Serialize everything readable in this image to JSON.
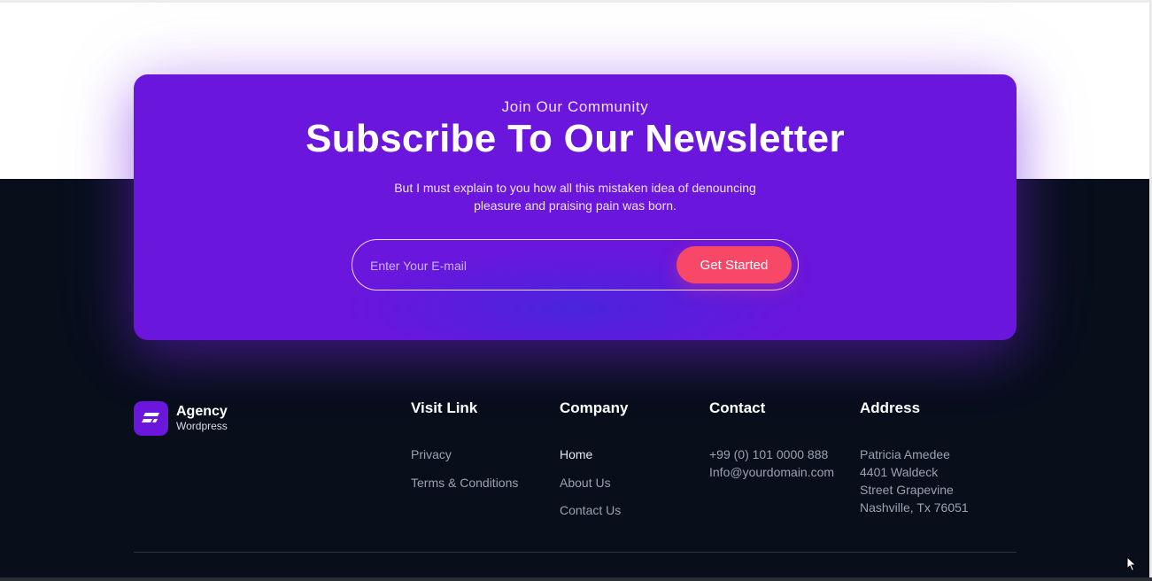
{
  "newsletter": {
    "kicker": "Join Our Community",
    "title": "Subscribe To Our Newsletter",
    "description_line1": "But I must explain to you how all this mistaken idea of denouncing",
    "description_line2": "pleasure and praising pain was born.",
    "email_placeholder": "Enter Your E-mail",
    "button_label": "Get Started"
  },
  "brand": {
    "name": "Agency",
    "subtitle": "Wordpress"
  },
  "footer": {
    "visit": {
      "heading": "Visit Link",
      "links": [
        "Privacy",
        "Terms & Conditions"
      ]
    },
    "company": {
      "heading": "Company",
      "links": [
        "Home",
        "About Us",
        "Contact Us"
      ]
    },
    "contact": {
      "heading": "Contact",
      "lines": [
        "+99 (0) 101 0000 888",
        "Info@yourdomain.com"
      ]
    },
    "address": {
      "heading": "Address",
      "lines": [
        "Patricia Amedee",
        "4401 Waldeck",
        "Street Grapevine",
        "Nashville, Tx 76051"
      ]
    }
  },
  "colors": {
    "newsletter_bg": "#6a16dc",
    "button_bg": "#f84868",
    "footer_bg": "#080f1b"
  },
  "icons": [
    "agency-logo-icon",
    "mouse-cursor-icon"
  ]
}
